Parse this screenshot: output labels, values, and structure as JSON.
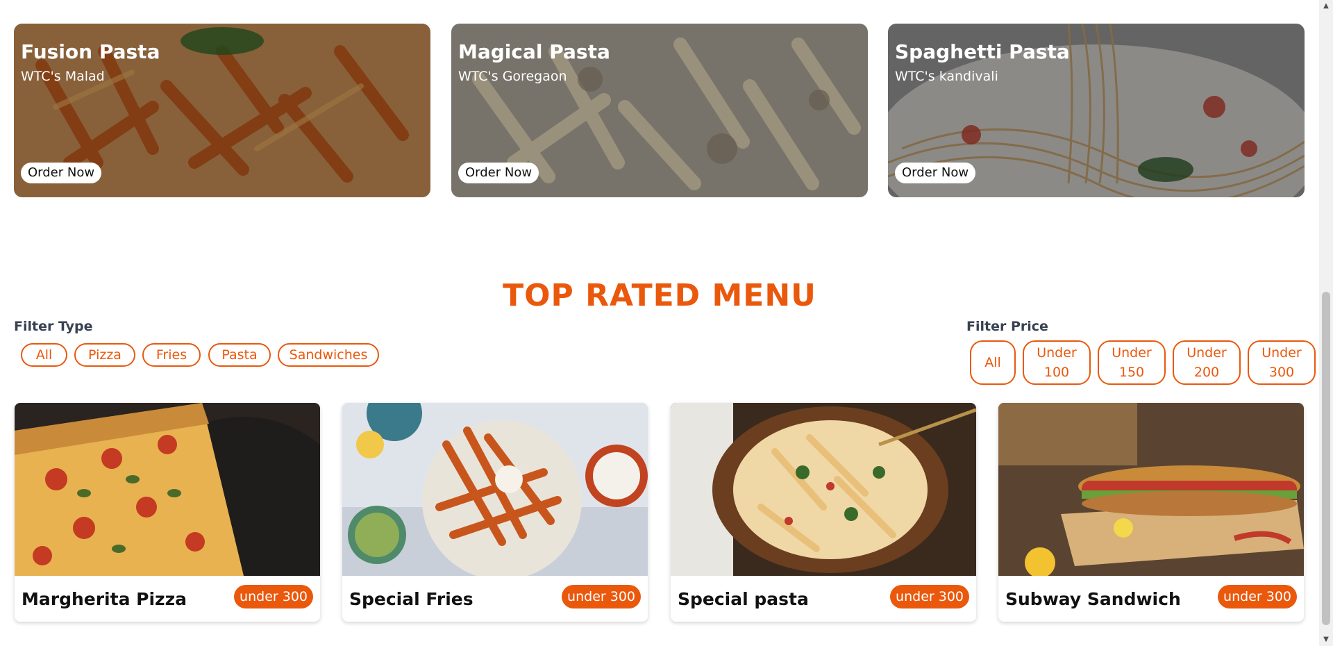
{
  "promos": [
    {
      "title": "Fusion Pasta",
      "location": "WTC's Malad",
      "button": "Order Now"
    },
    {
      "title": "Magical Pasta",
      "location": "WTC's Goregaon",
      "button": "Order Now"
    },
    {
      "title": "Spaghetti Pasta",
      "location": "WTC's kandivali",
      "button": "Order Now"
    }
  ],
  "section_title": "TOP RATED MENU",
  "filter_type": {
    "label": "Filter Type",
    "options": [
      "All",
      "Pizza",
      "Fries",
      "Pasta",
      "Sandwiches"
    ]
  },
  "filter_price": {
    "label": "Filter Price",
    "options": [
      {
        "line1": "All",
        "line2": ""
      },
      {
        "line1": "Under",
        "line2": "100"
      },
      {
        "line1": "Under",
        "line2": "150"
      },
      {
        "line1": "Under",
        "line2": "200"
      },
      {
        "line1": "Under",
        "line2": "300"
      }
    ]
  },
  "menu_items": [
    {
      "name": "Margherita Pizza",
      "badge": "under 300"
    },
    {
      "name": "Special Fries",
      "badge": "under 300"
    },
    {
      "name": "Special pasta",
      "badge": "under 300"
    },
    {
      "name": "Subway Sandwich",
      "badge": "under 300"
    }
  ],
  "colors": {
    "accent": "#ea580c",
    "label": "#374151"
  }
}
